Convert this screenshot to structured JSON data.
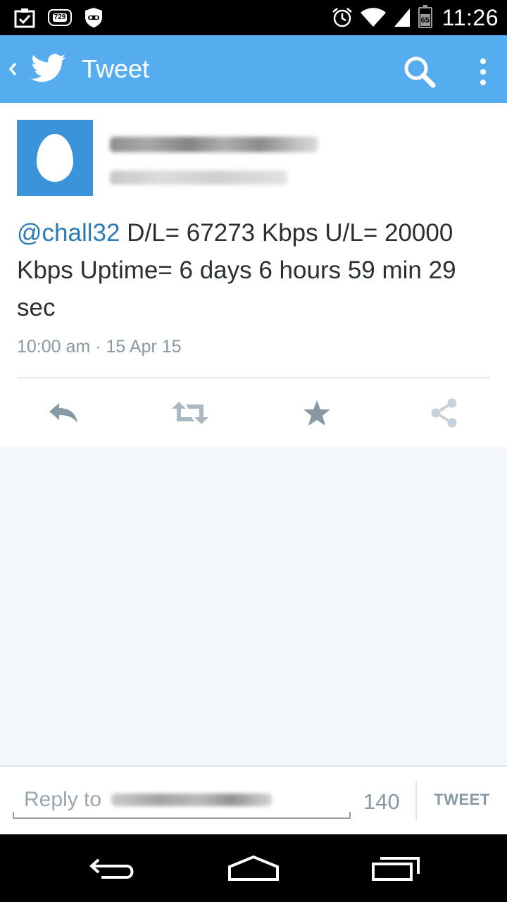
{
  "status_bar": {
    "time": "11:26",
    "notification_count": "729",
    "battery_level": "65",
    "icons": [
      "task-check-icon",
      "notification-badge-icon",
      "incognito-icon",
      "alarm-icon",
      "wifi-icon",
      "signal-icon",
      "battery-icon"
    ]
  },
  "app_bar": {
    "title": "Tweet",
    "icons": [
      "back-icon",
      "twitter-bird-icon",
      "search-icon",
      "overflow-menu-icon"
    ],
    "color": "#55acee"
  },
  "tweet": {
    "mention": "@chall32",
    "text": " D/L= 67273 Kbps U/L= 20000 Kbps Uptime= 6 days 6 hours 59 min 29 sec",
    "time": "10:00 am",
    "separator": "·",
    "date": "15 Apr 15",
    "actions": [
      "reply-icon",
      "retweet-icon",
      "favorite-icon",
      "share-icon"
    ]
  },
  "compose": {
    "placeholder": "Reply to",
    "char_count": "140",
    "tweet_button": "TWEET"
  },
  "nav_bar": {
    "icons": [
      "back-nav-icon",
      "home-nav-icon",
      "recents-nav-icon"
    ]
  },
  "colors": {
    "brand": "#55acee",
    "link": "#2b7bb9",
    "text": "#292f33",
    "muted": "#8899a6",
    "avatar": "#3b94d9",
    "background": "#f5f8fa"
  }
}
